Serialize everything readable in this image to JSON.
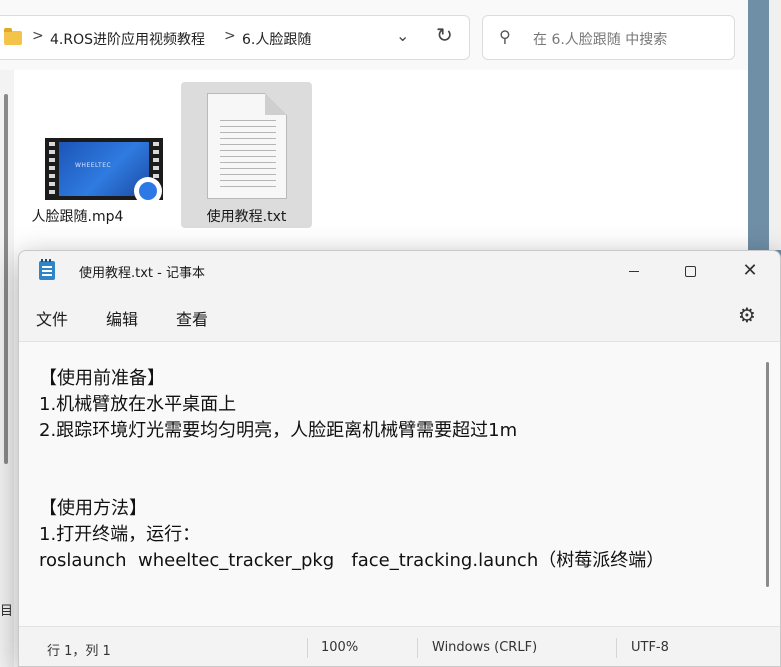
{
  "explorer": {
    "breadcrumb": [
      "4.ROS进阶应用视频教程",
      "6.人脸跟随"
    ],
    "breadcrumb_separator": ">",
    "search_placeholder": "在 6.人脸跟随 中搜索",
    "nav_cut_text": "目",
    "files": [
      {
        "name": "人脸跟随.mp4",
        "type": "video",
        "selected": false
      },
      {
        "name": "使用教程.txt",
        "type": "text",
        "selected": true
      }
    ],
    "video_thumb_text": "WHEELTEC"
  },
  "notepad": {
    "title": "使用教程.txt - 记事本",
    "menu": [
      "文件",
      "编辑",
      "查看"
    ],
    "lines": [
      "【使用前准备】",
      "1.机械臂放在水平桌面上",
      "2.跟踪环境灯光需要均匀明亮，人脸距离机械臂需要超过1m",
      "",
      "",
      "【使用方法】",
      "1.打开终端，运行：",
      "roslaunch  wheeltec_tracker_pkg   face_tracking.launch（树莓派终端）"
    ],
    "status": {
      "position": "行 1，列 1",
      "zoom": "100%",
      "line_ending": "Windows (CRLF)",
      "encoding": "UTF-8"
    }
  },
  "colors": {
    "accent": "#2c79e6",
    "notepad_icon": "#2e86c9",
    "folder": "#f4c44a",
    "desktop": "#6f8fa7"
  },
  "icons": {
    "folder": "folder-icon",
    "dropdown": "chevron-down-icon",
    "refresh": "refresh-icon",
    "search": "search-icon",
    "app": "notepad-icon",
    "minimize": "minimize-icon",
    "maximize": "maximize-icon",
    "close": "close-icon",
    "settings": "gear-icon"
  }
}
